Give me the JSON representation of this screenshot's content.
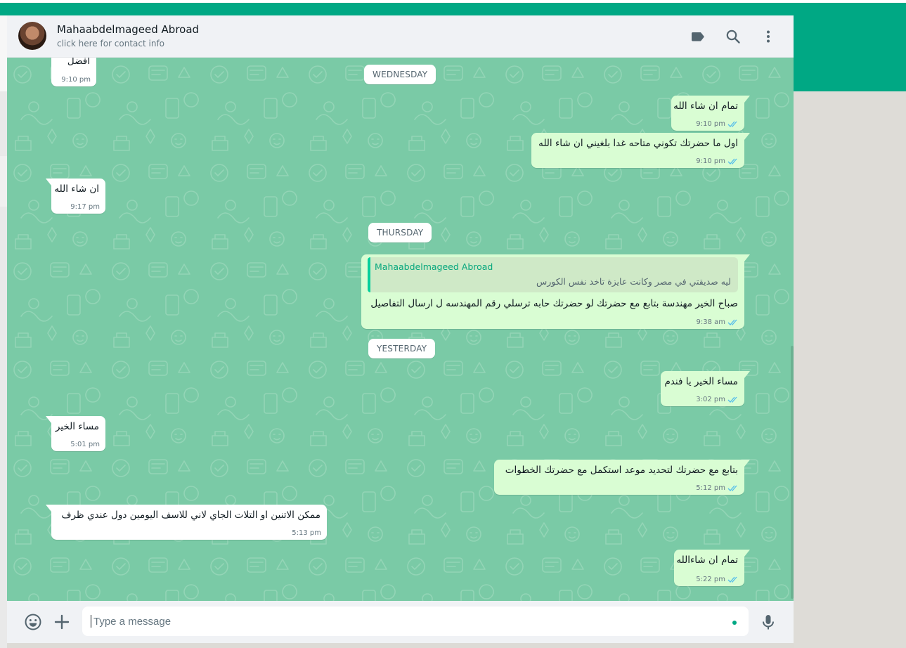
{
  "contact": {
    "name": "Mahaabdelmageed Abroad",
    "subtitle": "click here for contact info"
  },
  "header_icons": [
    "label-icon",
    "search-icon",
    "menu-icon"
  ],
  "dates": {
    "wednesday": "WEDNESDAY",
    "thursday": "THURSDAY",
    "yesterday": "YESTERDAY"
  },
  "messages": [
    {
      "dir": "in",
      "text": "افضل",
      "time": "9:10 pm"
    },
    {
      "dir": "out",
      "text": "تمام ان شاء الله",
      "time": "9:10 pm",
      "status": "read"
    },
    {
      "dir": "out",
      "text": "اول ما حضرتك تكوني متاحه غدا بلغيني ان شاء الله",
      "time": "9:10 pm",
      "status": "read"
    },
    {
      "dir": "in",
      "text": "ان شاء الله",
      "time": "9:17 pm"
    },
    {
      "dir": "out",
      "text": "صباح الخير مهندسة بتابع مع حضرتك لو حضرتك حابه ترسلي رقم المهندسه ل ارسال التفاصيل",
      "time": "9:38 am",
      "status": "read",
      "quote": {
        "author": "Mahaabdelmageed Abroad",
        "text": "ليه صديقتي في مصر وكانت عايزة تاخد نفس الكورس"
      }
    },
    {
      "dir": "out",
      "text": "مساء الخير يا فندم",
      "time": "3:02 pm",
      "status": "read"
    },
    {
      "dir": "in",
      "text": "مساء الخير",
      "time": "5:01 pm"
    },
    {
      "dir": "out",
      "text": "بتابع مع حضرتك لتحديد موعد استكمل مع حضرتك الخطوات",
      "time": "5:12 pm",
      "status": "read"
    },
    {
      "dir": "in",
      "text": "ممكن الاتنين او التلات الجاي لاني للاسف اليومين دول عندي ظرف",
      "time": "5:13 pm"
    },
    {
      "dir": "out",
      "text": "تمام ان شاءالله",
      "time": "5:22 pm",
      "status": "read"
    }
  ],
  "composer": {
    "placeholder": "Type a message",
    "value": ""
  },
  "colors": {
    "brand": "#00a884",
    "chat_bg": "#7acaa6",
    "outgoing": "#d9fdd3",
    "incoming": "#ffffff",
    "read_tick": "#53bdeb"
  }
}
